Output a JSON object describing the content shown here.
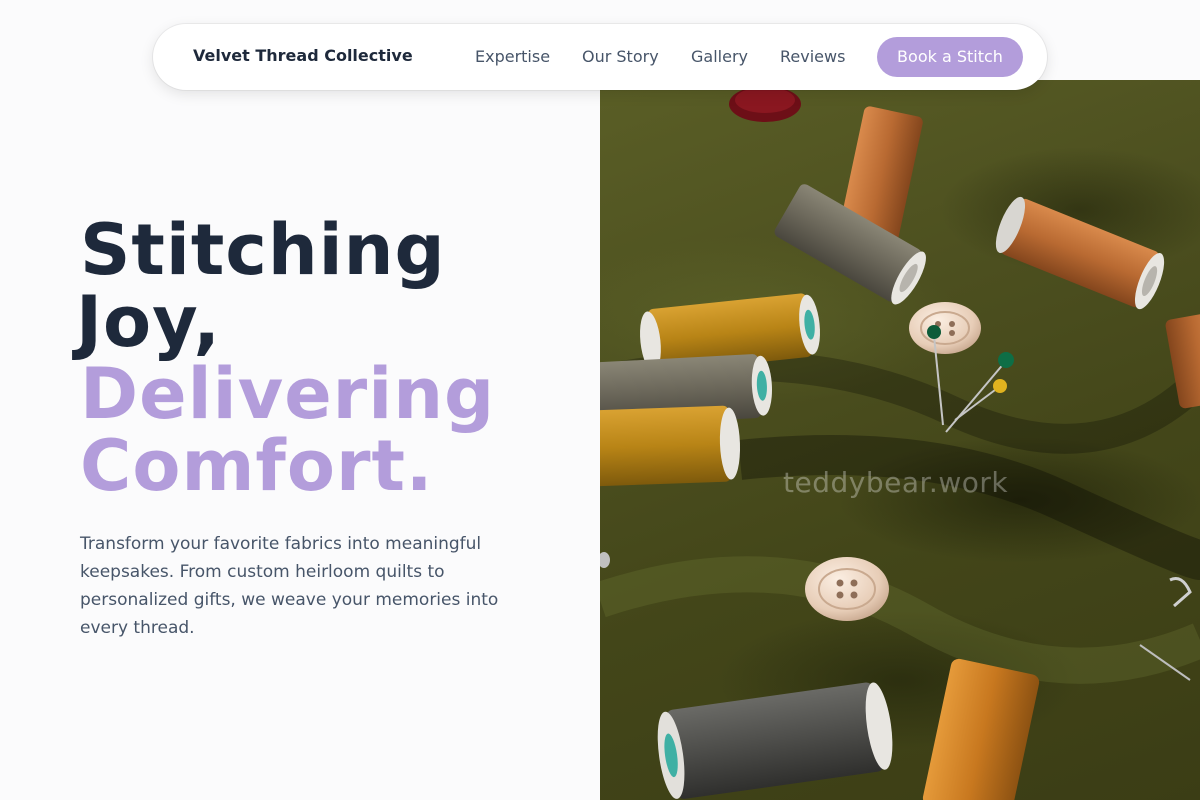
{
  "nav": {
    "brand": "Velvet Thread Collective",
    "links": [
      {
        "label": "Expertise"
      },
      {
        "label": "Our Story"
      },
      {
        "label": "Gallery"
      },
      {
        "label": "Reviews"
      }
    ],
    "cta_label": "Book a Stitch"
  },
  "hero": {
    "headline_line1": "Stitching",
    "headline_line2": "Joy,",
    "headline_line3": "Delivering",
    "headline_line4": "Comfort.",
    "description": "Transform your favorite fabrics into meaningful keepsakes. From custom heirloom quilts to personalized gifts, we weave your memories into every thread.",
    "image_watermark": "teddybear.work"
  },
  "colors": {
    "accent": "#b39ddb",
    "heading": "#1e293b",
    "body_text": "#475569",
    "fabric": "#4c4f1f"
  }
}
